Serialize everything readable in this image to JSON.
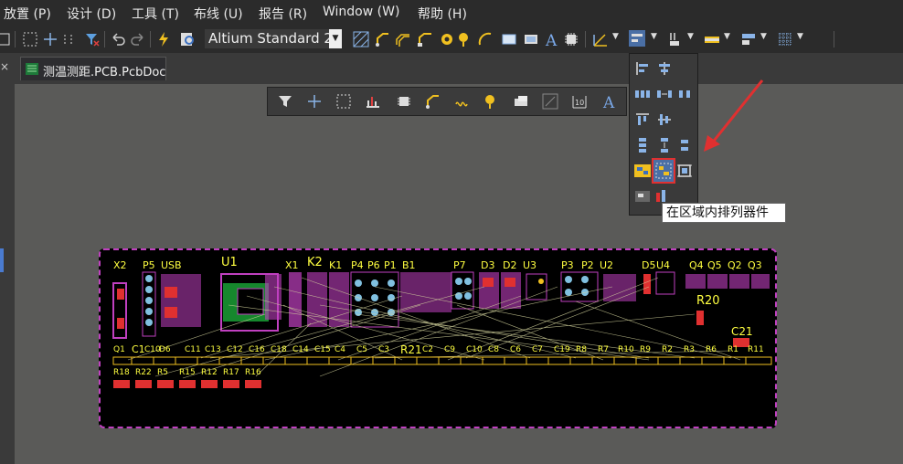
{
  "menu": [
    {
      "label": "放置 (P)",
      "key": "place"
    },
    {
      "label": "设计 (D)",
      "key": "design"
    },
    {
      "label": "工具 (T)",
      "key": "tools"
    },
    {
      "label": "布线 (U)",
      "key": "route"
    },
    {
      "label": "报告 (R)",
      "key": "reports"
    },
    {
      "label": "Window (W)",
      "key": "window"
    },
    {
      "label": "帮助 (H)",
      "key": "help"
    }
  ],
  "toolbar": {
    "standard_select": "Altium Standard 2"
  },
  "tabs": {
    "document": "测温测距.PCB.PcbDoc"
  },
  "tooltip": {
    "text": "在区域内排列器件"
  },
  "board": {
    "designators": [
      "X2",
      "P5",
      "USB",
      "U1",
      "X1",
      "K2",
      "K1",
      "P4",
      "P6",
      "P1",
      "B1",
      "P7",
      "D3",
      "D2",
      "U3",
      "P3",
      "P2",
      "U2",
      "D5",
      "U4",
      "Q4",
      "Q5",
      "Q2",
      "Q3",
      "R20",
      "C21",
      "Q1",
      "C1",
      "C10",
      "D6",
      "C11",
      "C13",
      "C12",
      "C16",
      "C18",
      "C14",
      "C15",
      "C4",
      "C5",
      "C3",
      "R21",
      "C2",
      "C9",
      "C10",
      "C8",
      "C6",
      "C7",
      "C19",
      "R8",
      "R7",
      "R10",
      "R9",
      "R2",
      "R3",
      "R6",
      "R1",
      "R11",
      "R18",
      "R22",
      "R5",
      "R15",
      "R12",
      "R17",
      "R16"
    ]
  },
  "colors": {
    "board_outline": "#c040c0",
    "designator_text": "#ffff40",
    "highlight": "#e03030"
  }
}
